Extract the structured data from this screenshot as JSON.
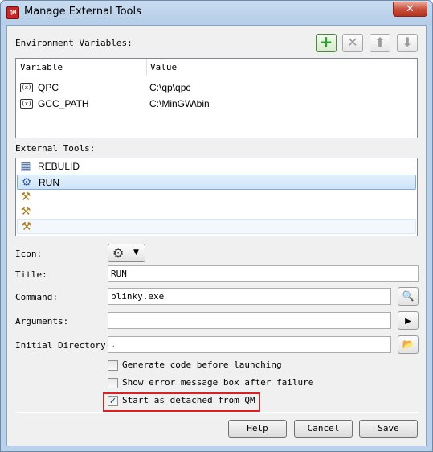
{
  "window": {
    "title": "Manage External Tools",
    "app_icon_text": "QM",
    "close_glyph": "✕"
  },
  "env": {
    "section_label": "Environment Variables:",
    "toolbar": {
      "add_glyph": "+",
      "delete_glyph": "✕",
      "up_glyph": "⬆",
      "down_glyph": "⬇"
    },
    "columns": [
      "Variable",
      "Value"
    ],
    "icon_text": "(x)",
    "rows": [
      {
        "variable": "QPC",
        "value": "C:\\qp\\qpc"
      },
      {
        "variable": "GCC_PATH",
        "value": "C:\\MinGW\\bin"
      }
    ]
  },
  "tools": {
    "section_label": "External Tools:",
    "items": [
      {
        "label": "REBULID",
        "icon": "calendar-icon",
        "glyph": "▦",
        "state": "normal"
      },
      {
        "label": "RUN",
        "icon": "gear-icon",
        "glyph": "⚙",
        "state": "selected"
      },
      {
        "label": "",
        "icon": "tools-icon",
        "glyph": "⚒",
        "state": "normal"
      },
      {
        "label": "",
        "icon": "tools-icon",
        "glyph": "⚒",
        "state": "normal"
      },
      {
        "label": "",
        "icon": "tools-icon",
        "glyph": "⚒",
        "state": "hover"
      }
    ]
  },
  "form": {
    "icon_label": "Icon:",
    "icon_glyph": "⚙",
    "dropdown_glyph": "▼",
    "title_label": "Title:",
    "title_value": "RUN",
    "command_label": "Command:",
    "command_value": "blinky.exe",
    "browse_glyph": "🔍",
    "arguments_label": "Arguments:",
    "arguments_value": "",
    "arguments_glyph": "▶",
    "initdir_label": "Initial Directory:",
    "initdir_value": ".",
    "folder_glyph": "📂"
  },
  "options": [
    {
      "label": "Generate code before launching",
      "checked": false
    },
    {
      "label": "Show error message box after failure",
      "checked": false
    },
    {
      "label": "Start as detached from QM",
      "checked": true
    }
  ],
  "checkmark_glyph": "✓",
  "buttons": {
    "help": "Help",
    "cancel": "Cancel",
    "save": "Save"
  },
  "colors": {
    "selection": "#cfe4f8",
    "highlight_box": "#e02020",
    "add_button": "#2ea02e"
  }
}
